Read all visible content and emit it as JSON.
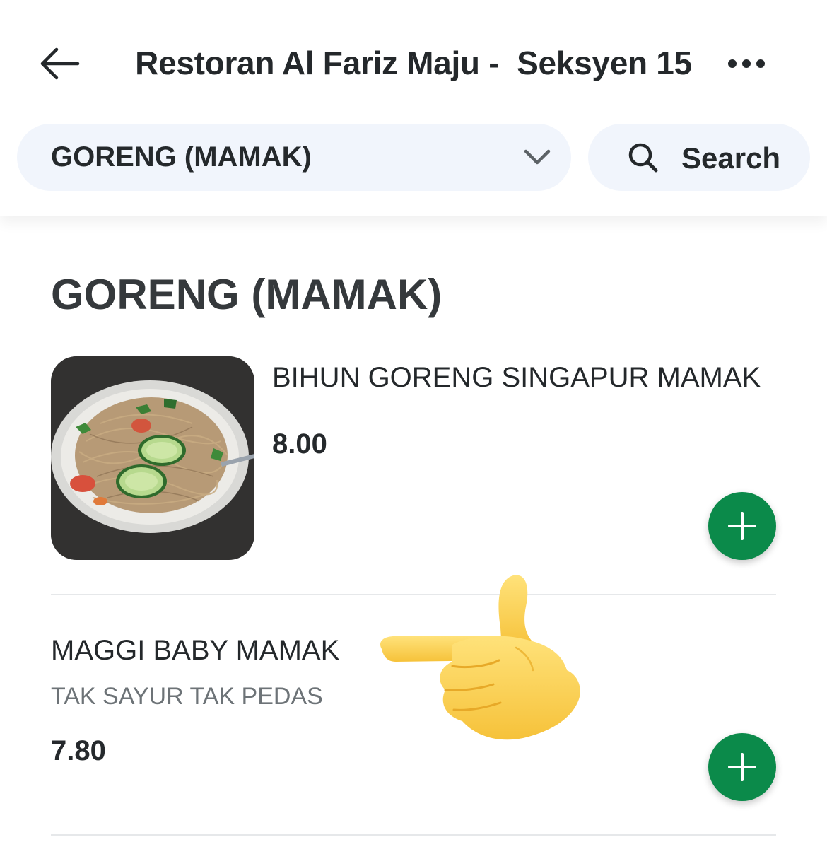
{
  "header": {
    "title": "Restoran Al Fariz Maju -  Seksyen 15",
    "back_icon": "arrow-left-icon",
    "more_icon": "more-horizontal-icon"
  },
  "toolbar": {
    "category_selected": "GORENG (MAMAK)",
    "category_icon": "chevron-down-icon",
    "search_label": "Search",
    "search_icon": "search-icon"
  },
  "section": {
    "title": "GORENG (MAMAK)"
  },
  "items": [
    {
      "name": "BIHUN GORENG SINGAPUR MAMAK",
      "price": "8.00",
      "has_image": true
    },
    {
      "name": "MAGGI BABY MAMAK",
      "description": "TAK SAYUR TAK PEDAS",
      "price": "7.80",
      "has_image": false
    }
  ],
  "overlay": {
    "pointing_hand_icon": "pointing-left-hand-emoji"
  },
  "colors": {
    "accent_green": "#0b8a4a",
    "pill_background": "#f1f5fc",
    "text_primary": "#24282b",
    "text_secondary": "#6d7377"
  }
}
